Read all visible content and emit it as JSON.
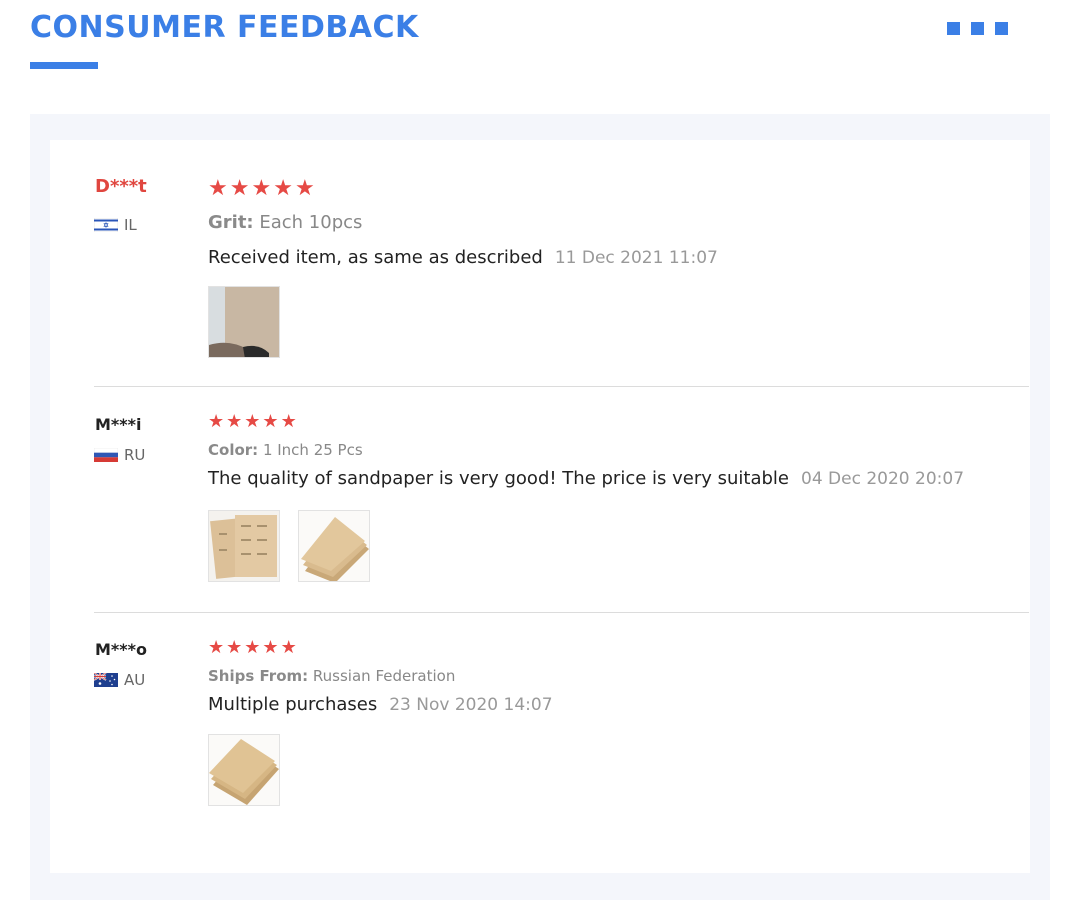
{
  "header": {
    "title": "CONSUMER FEEDBACK"
  },
  "reviews": [
    {
      "user": "D***t",
      "country": "IL",
      "rating": 5,
      "attribute_key": "Grit:",
      "attribute_value": "Each 10pcs",
      "comment": "Received  item, as same as described",
      "date": "11 Dec 2021 11:07"
    },
    {
      "user": "M***i",
      "country": "RU",
      "rating": 5,
      "attribute_key": "Color:",
      "attribute_value": "1 Inch 25 Pcs",
      "comment": "The quality of sandpaper is very good!  The price is very suitable",
      "date": "04 Dec 2020 20:07"
    },
    {
      "user": "M***o",
      "country": "AU",
      "rating": 5,
      "attribute_key": "Ships From:",
      "attribute_value": "Russian Federation",
      "comment": "Multiple purchases",
      "date": "23 Nov 2020 14:07"
    }
  ],
  "colors": {
    "accent": "#3b7fe6",
    "star": "#e64a45",
    "username_highlight": "#e0463f"
  }
}
